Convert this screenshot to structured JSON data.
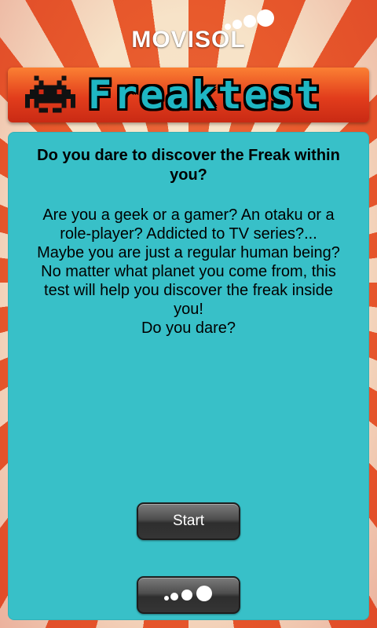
{
  "brand": {
    "name": "MOVISOL",
    "icon": "dots-logo-icon"
  },
  "banner": {
    "title": "Freaktest",
    "icon": "space-invader-icon"
  },
  "content": {
    "heading": "Do you dare to discover the Freak within you?",
    "paragraph_lines": [
      "Are you a geek or a gamer? An otaku or a",
      "role-player? Addicted to TV series?...",
      "Maybe you are just a regular human being?",
      "No matter what planet you come from, this",
      "test will help you discover the freak inside",
      "you!",
      "Do you dare?"
    ]
  },
  "buttons": {
    "start_label": "Start",
    "more_icon": "more-apps-dots-icon"
  },
  "colors": {
    "panel": "#38c0c8",
    "banner": "#e23d1c",
    "stripe_red": "#e85a2c",
    "stripe_light": "#f7e3c8",
    "title_text": "#1fb6c3"
  }
}
